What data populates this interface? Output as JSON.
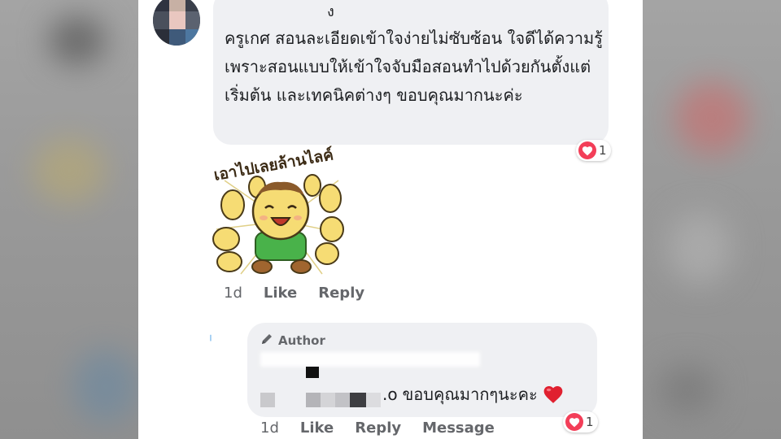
{
  "comment": {
    "name_fragment": "ง",
    "text": "ครูเกศ สอนละเอียดเข้าใจง่ายไม่ซับซ้อน ใจดีได้ความรู้เพราะสอนแบบให้เข้าใจจับมือสอนทำไปด้วยกันตั้งแต่เริ่มต้น และเทคนิคต่างๆ ขอบคุณมากนะค่ะ",
    "reaction_count": "1",
    "reaction_icon": "heart-icon",
    "sticker_caption": "เอาไปเลยล้านไลค์",
    "actions": {
      "time": "1d",
      "like": "Like",
      "reply": "Reply"
    }
  },
  "reply": {
    "badge_label": "Author",
    "badge_icon": "pencil-icon",
    "text_prefix": ".o",
    "text": "ขอบคุณมากๆนะคะ",
    "emoji": "red-heart-emoji",
    "reaction_count": "1",
    "reaction_icon": "heart-icon",
    "actions": {
      "time": "1d",
      "like": "Like",
      "reply": "Reply",
      "message": "Message"
    }
  },
  "colors": {
    "bubble": "#eff0f3",
    "text": "#1c1e21",
    "meta": "#65676b",
    "heart": "#f33e58"
  }
}
